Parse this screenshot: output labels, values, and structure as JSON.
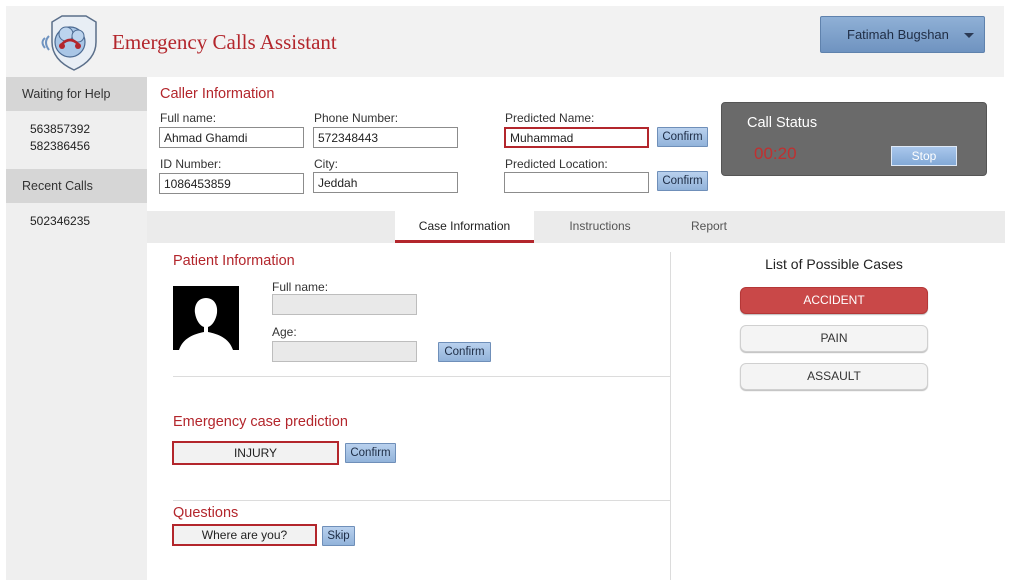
{
  "header": {
    "app_title": "Emergency Calls Assistant",
    "user_name": "Fatimah Bugshan"
  },
  "sidebar": {
    "waiting_title": "Waiting for Help",
    "waiting_items": [
      "563857392",
      "582386456"
    ],
    "recent_title": "Recent Calls",
    "recent_items": [
      "502346235"
    ]
  },
  "caller": {
    "title": "Caller Information",
    "full_name_label": "Full name:",
    "full_name": "Ahmad Ghamdi",
    "phone_label": "Phone Number:",
    "phone": "572348443",
    "id_label": "ID Number:",
    "id_number": "1086453859",
    "city_label": "City:",
    "city": "Jeddah",
    "predicted_name_label": "Predicted Name:",
    "predicted_name": "Muhammad",
    "predicted_location_label": "Predicted Location:",
    "predicted_location": "",
    "confirm_label": "Confirm"
  },
  "call_status": {
    "title": "Call Status",
    "timer": "00:20",
    "stop_label": "Stop"
  },
  "tabs": [
    {
      "label": "Case Information",
      "active": true
    },
    {
      "label": "Instructions",
      "active": false
    },
    {
      "label": "Report",
      "active": false
    }
  ],
  "patient": {
    "title": "Patient Information",
    "full_name_label": "Full name:",
    "age_label": "Age:",
    "confirm_label": "Confirm"
  },
  "prediction": {
    "title": "Emergency case prediction",
    "value": "INJURY",
    "confirm_label": "Confirm"
  },
  "questions": {
    "title": "Questions",
    "current": "Where are you?",
    "skip_label": "Skip"
  },
  "cases": {
    "title": "List of Possible Cases",
    "items": [
      {
        "label": "ACCIDENT",
        "selected": true
      },
      {
        "label": "PAIN",
        "selected": false
      },
      {
        "label": "ASSAULT",
        "selected": false
      }
    ]
  },
  "colors": {
    "accent_red": "#b3262c",
    "button_blue": "#92b3da",
    "status_gray": "#6a6a6a"
  }
}
